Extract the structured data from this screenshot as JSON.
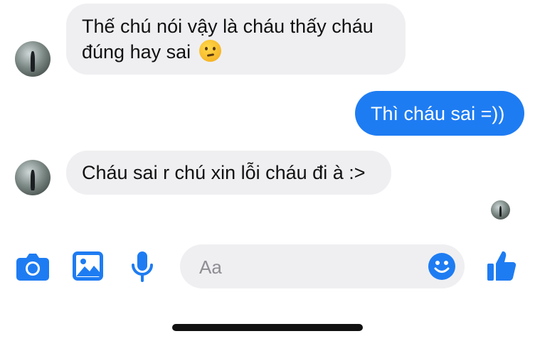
{
  "messages": [
    {
      "direction": "incoming",
      "text_line1": "Thế chú nói vậy là cháu thấy cháu",
      "text_line2": "đúng hay sai",
      "emoji": "thinking-face"
    },
    {
      "direction": "outgoing",
      "text": "Thì cháu sai =))"
    },
    {
      "direction": "incoming",
      "text": "Cháu sai r chú xin lỗi cháu đi à :>"
    }
  ],
  "composer": {
    "placeholder": "Aa"
  },
  "toolbar": {
    "icons": [
      "camera-icon",
      "image-icon",
      "microphone-icon",
      "emoji-icon",
      "like-icon"
    ]
  },
  "colors": {
    "accent": "#1e7cf2",
    "incoming_bubble": "#efeff2",
    "outgoing_text": "#ffffff"
  }
}
